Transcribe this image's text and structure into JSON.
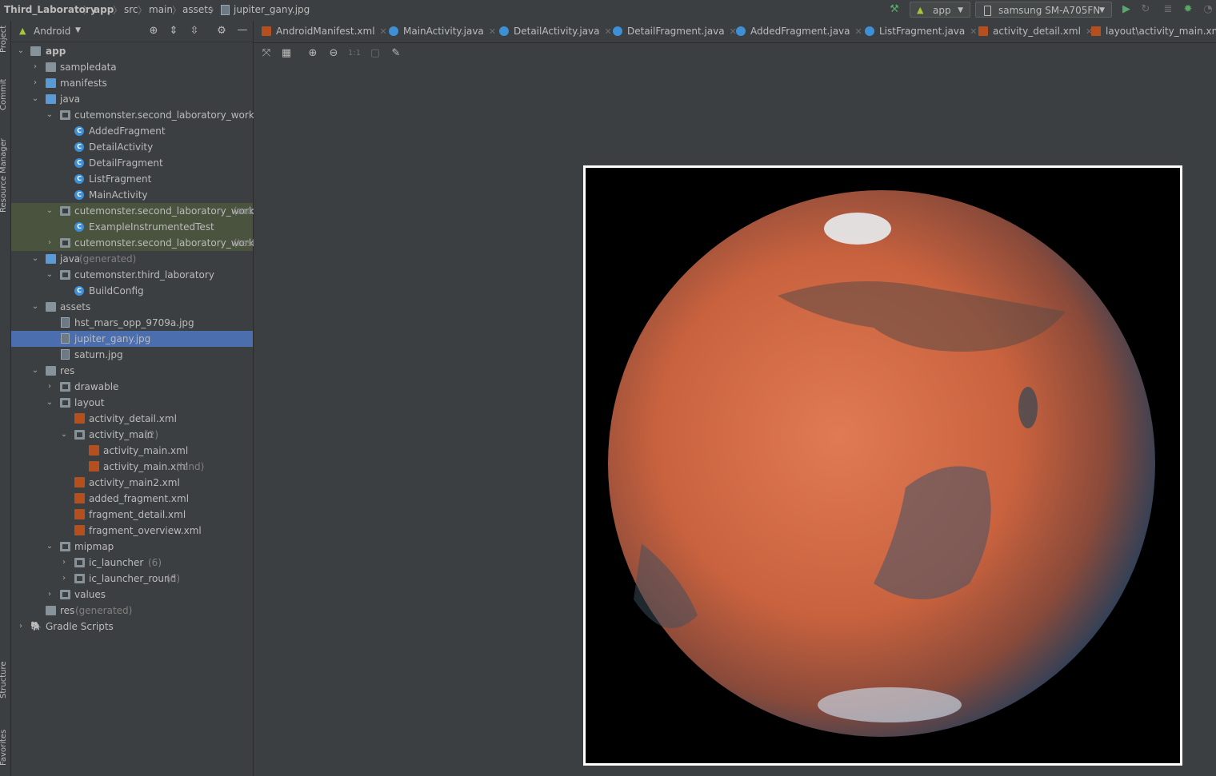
{
  "breadcrumb": [
    "Third_Laboratory",
    "app",
    "src",
    "main",
    "assets",
    "jupiter_gany.jpg"
  ],
  "run_config": {
    "label": "app"
  },
  "device": {
    "label": "samsung SM-A705FN"
  },
  "left_stripe": [
    "Project",
    "Commit",
    "Resource Manager",
    "Structure",
    "Favorites"
  ],
  "project_panel": {
    "view": "Android"
  },
  "tree": [
    {
      "label": "app",
      "extra": ""
    },
    {
      "label": "sampledata",
      "extra": ""
    },
    {
      "label": "manifests",
      "extra": ""
    },
    {
      "label": "java",
      "extra": ""
    },
    {
      "label": "cutemonster.second_laboratory_work",
      "extra": ""
    },
    {
      "label": "AddedFragment",
      "extra": ""
    },
    {
      "label": "DetailActivity",
      "extra": ""
    },
    {
      "label": "DetailFragment",
      "extra": ""
    },
    {
      "label": "ListFragment",
      "extra": ""
    },
    {
      "label": "MainActivity",
      "extra": ""
    },
    {
      "label": "cutemonster.second_laboratory_work",
      "extra": "(and"
    },
    {
      "label": "ExampleInstrumentedTest",
      "extra": ""
    },
    {
      "label": "cutemonster.second_laboratory_work",
      "extra": "(test"
    },
    {
      "label": "java",
      "extra": "(generated)"
    },
    {
      "label": "cutemonster.third_laboratory",
      "extra": ""
    },
    {
      "label": "BuildConfig",
      "extra": ""
    },
    {
      "label": "assets",
      "extra": ""
    },
    {
      "label": "hst_mars_opp_9709a.jpg",
      "extra": ""
    },
    {
      "label": "jupiter_gany.jpg",
      "extra": ""
    },
    {
      "label": "saturn.jpg",
      "extra": ""
    },
    {
      "label": "res",
      "extra": ""
    },
    {
      "label": "drawable",
      "extra": ""
    },
    {
      "label": "layout",
      "extra": ""
    },
    {
      "label": "activity_detail.xml",
      "extra": ""
    },
    {
      "label": "activity_main",
      "extra": "(2)"
    },
    {
      "label": "activity_main.xml",
      "extra": ""
    },
    {
      "label": "activity_main.xml",
      "extra": "(land)"
    },
    {
      "label": "activity_main2.xml",
      "extra": ""
    },
    {
      "label": "added_fragment.xml",
      "extra": ""
    },
    {
      "label": "fragment_detail.xml",
      "extra": ""
    },
    {
      "label": "fragment_overview.xml",
      "extra": ""
    },
    {
      "label": "mipmap",
      "extra": ""
    },
    {
      "label": "ic_launcher",
      "extra": "(6)"
    },
    {
      "label": "ic_launcher_round",
      "extra": "(6)"
    },
    {
      "label": "values",
      "extra": ""
    },
    {
      "label": "res",
      "extra": "(generated)"
    },
    {
      "label": "Gradle Scripts",
      "extra": ""
    }
  ],
  "tabs": [
    {
      "label": "AndroidManifest.xml"
    },
    {
      "label": "MainActivity.java"
    },
    {
      "label": "DetailActivity.java"
    },
    {
      "label": "DetailFragment.java"
    },
    {
      "label": "AddedFragment.java"
    },
    {
      "label": "ListFragment.java"
    },
    {
      "label": "activity_detail.xml"
    },
    {
      "label": "layout\\activity_main.xml"
    }
  ],
  "image_toolbar": {
    "actual_size_label": "1:1"
  },
  "colors": {
    "selection": "#4b6eaf",
    "test_bg": "#49533d",
    "panel_bg": "#3c3f41"
  }
}
